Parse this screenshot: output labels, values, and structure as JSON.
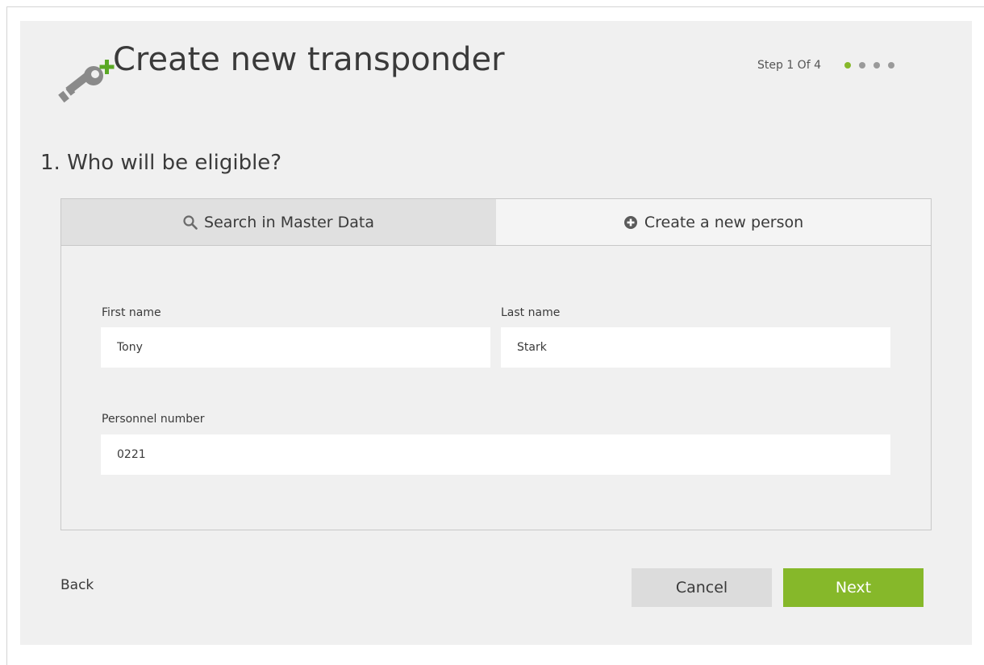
{
  "header": {
    "title": "Create new transponder",
    "step_label": "Step 1 Of 4",
    "total_steps": 4,
    "current_step": 1,
    "icon": "key-add-icon"
  },
  "question": "1. Who will be eligible?",
  "tabs": [
    {
      "label": "Search in Master Data",
      "icon": "search-icon",
      "active": false
    },
    {
      "label": "Create a new person",
      "icon": "plus-circle-icon",
      "active": true
    }
  ],
  "form": {
    "first_name": {
      "label": "First name",
      "value": "Tony"
    },
    "last_name": {
      "label": "Last name",
      "value": "Stark"
    },
    "personnel_number": {
      "label": "Personnel number",
      "value": "0221"
    }
  },
  "footer": {
    "back_label": "Back",
    "cancel_label": "Cancel",
    "next_label": "Next"
  },
  "colors": {
    "accent": "#86b82a",
    "background": "#f0f0f0",
    "inactive_dot": "#9a9a9a"
  }
}
